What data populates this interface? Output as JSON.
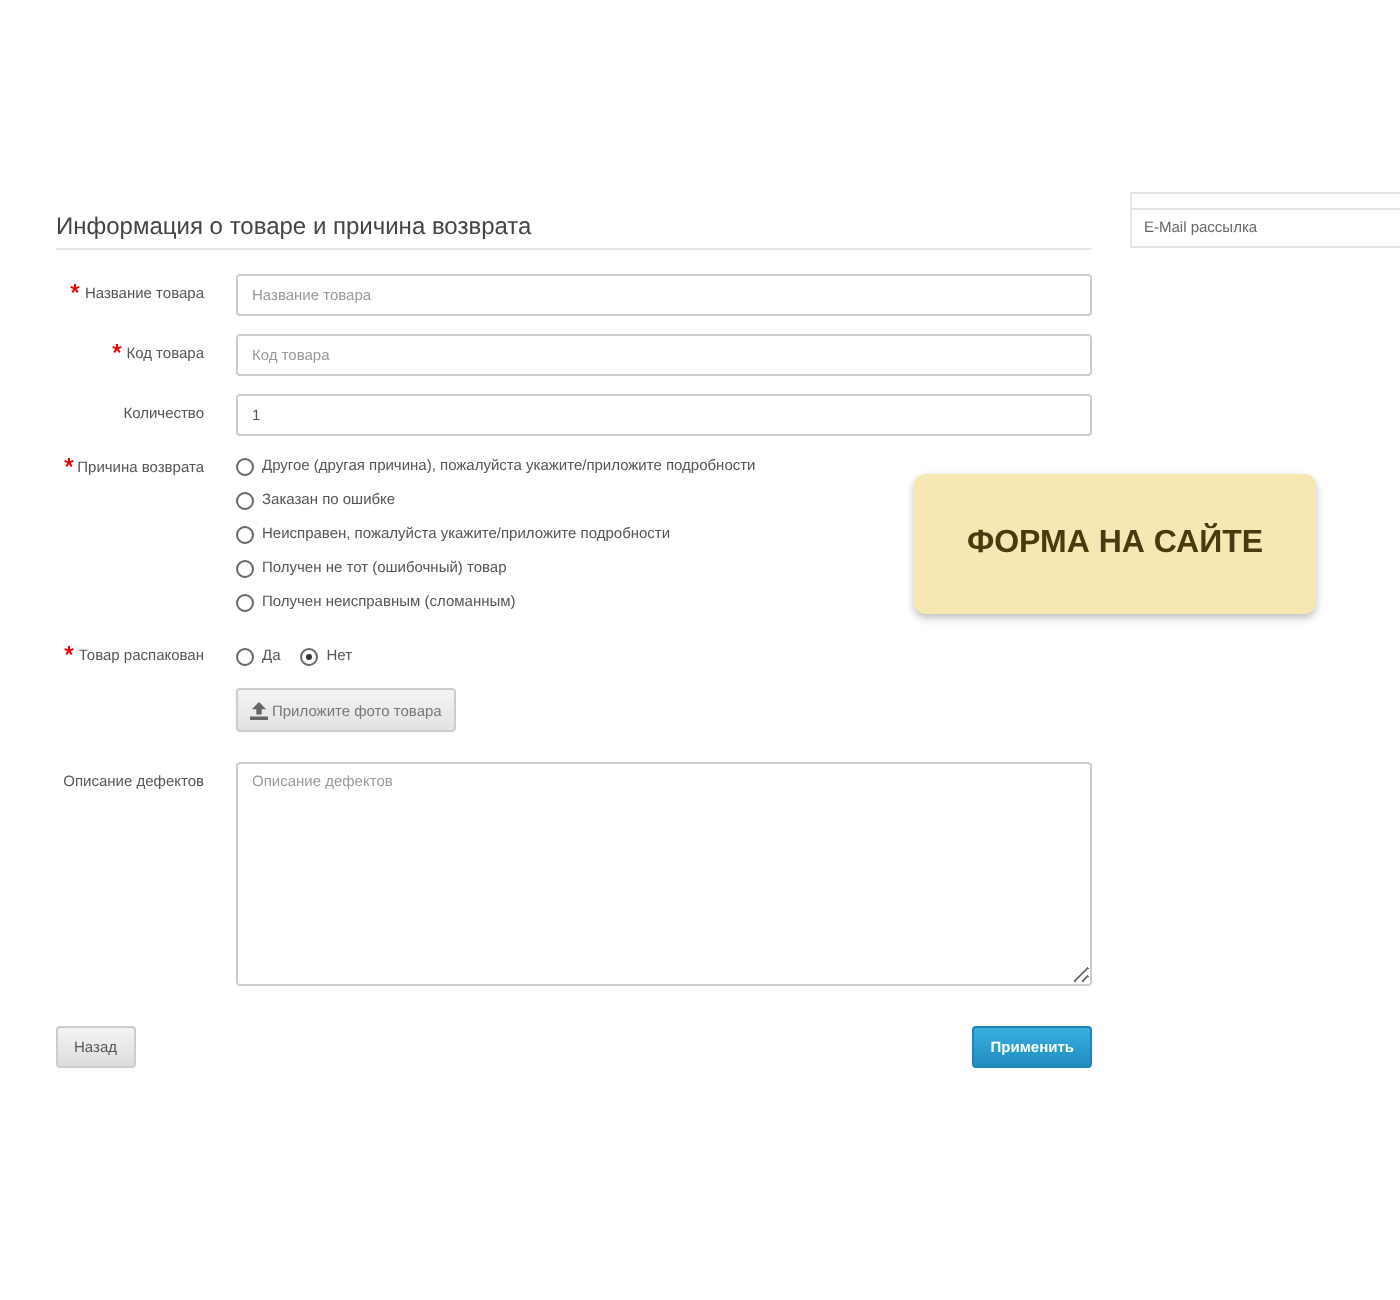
{
  "heading": "Информация о товаре и причина возврата",
  "sidebar": {
    "items": [
      "E-Mail рассылка"
    ]
  },
  "fields": [
    {
      "kind": "text",
      "label": "Название товара",
      "required": true,
      "placeholder": "Название товара"
    },
    {
      "kind": "text",
      "label": "Код товара",
      "required": true,
      "placeholder": "Код товара"
    },
    {
      "kind": "text",
      "label": "Количество",
      "required": false,
      "value": "1"
    },
    {
      "kind": "radio-list",
      "label": "Причина возврата",
      "required": true,
      "options": [
        {
          "label": "Другое (другая причина), пожалуйста укажите/приложите подробности",
          "selected": false
        },
        {
          "label": "Заказан по ошибке",
          "selected": false
        },
        {
          "label": "Неисправен, пожалуйста укажите/приложите подробности",
          "selected": false
        },
        {
          "label": "Получен не тот (ошибочный) товар",
          "selected": false
        },
        {
          "label": "Получен неисправным (сломанным)",
          "selected": false
        }
      ]
    },
    {
      "kind": "radio-inline",
      "label": "Товар распакован",
      "required": true,
      "options": [
        {
          "label": "Да",
          "selected": false
        },
        {
          "label": "Нет",
          "selected": true
        }
      ]
    },
    {
      "kind": "upload",
      "button": "Приложите фото товара"
    },
    {
      "kind": "textarea",
      "label": "Описание дефектов",
      "required": false,
      "placeholder": "Описание дефектов"
    }
  ],
  "buttons": {
    "back": "Назад",
    "submit": "Применить"
  },
  "badge": "ФОРМА НА САЙТЕ"
}
